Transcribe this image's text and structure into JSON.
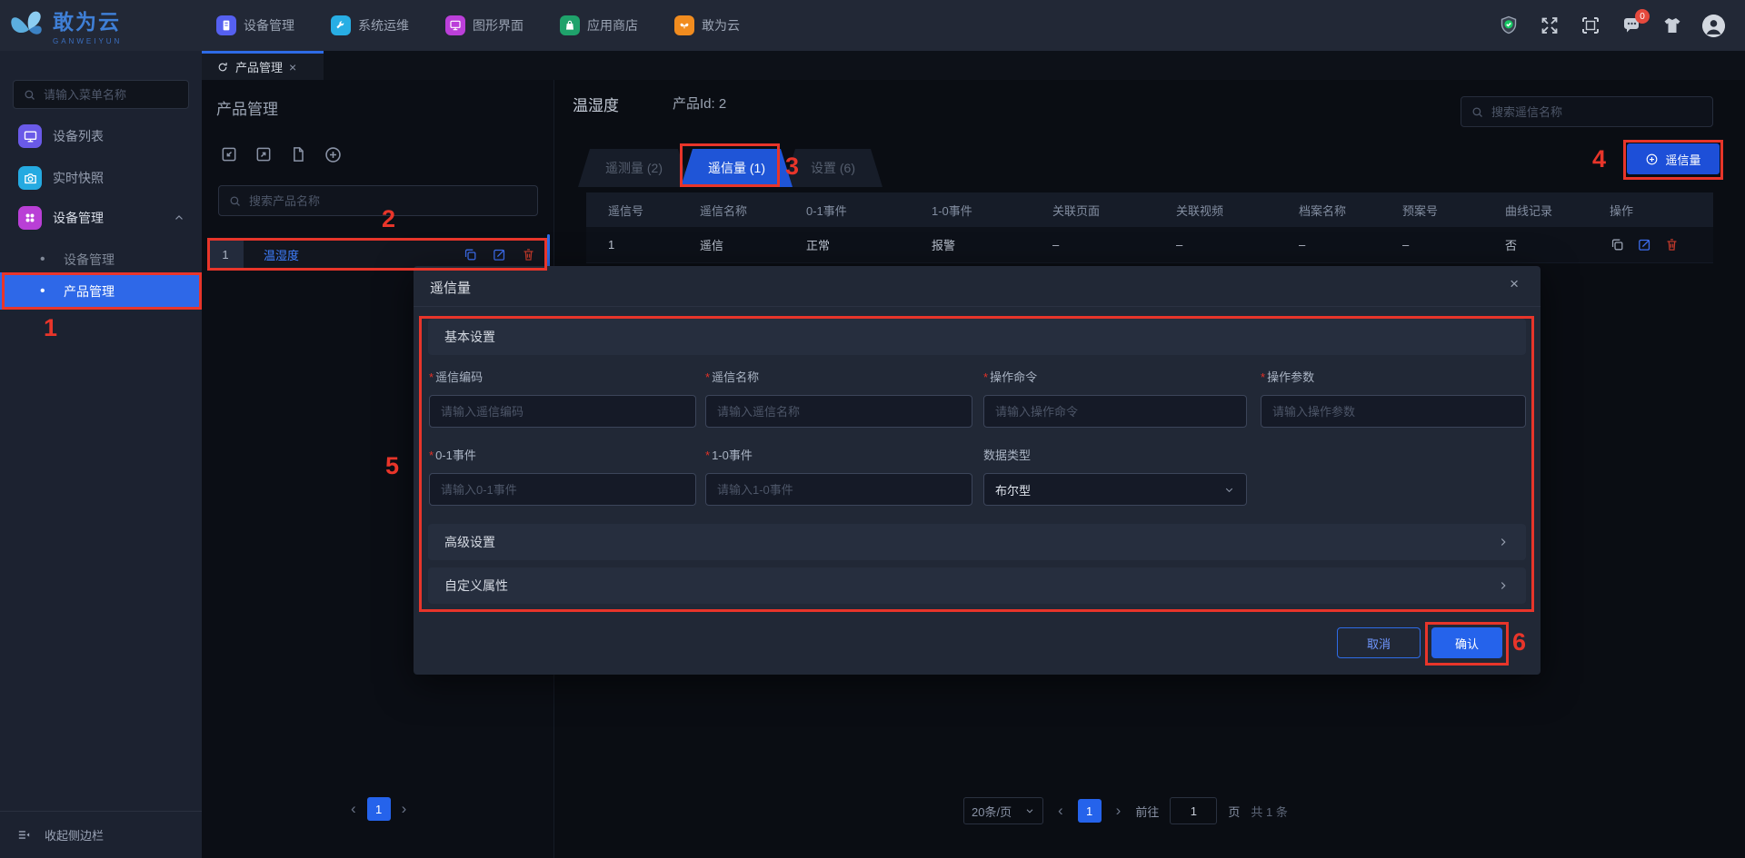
{
  "topbar": {
    "logo": {
      "title": "敢为云",
      "subtitle": "GANWEIYUN"
    },
    "nav": [
      {
        "label": "设备管理"
      },
      {
        "label": "系统运维"
      },
      {
        "label": "图形界面"
      },
      {
        "label": "应用商店"
      },
      {
        "label": "敢为云"
      }
    ],
    "message_badge": "0"
  },
  "doc_tab": {
    "label": "产品管理"
  },
  "sidebar": {
    "search_placeholder": "请输入菜单名称",
    "items": [
      {
        "label": "设备列表"
      },
      {
        "label": "实时快照"
      },
      {
        "label": "设备管理"
      }
    ],
    "sub_items": [
      {
        "label": "设备管理"
      },
      {
        "label": "产品管理"
      }
    ],
    "collapse_label": "收起侧边栏"
  },
  "product_panel": {
    "title": "产品管理",
    "search_placeholder": "搜索产品名称",
    "row": {
      "index": "1",
      "name": "温湿度"
    },
    "pagination": {
      "current": "1"
    }
  },
  "content": {
    "product_name": "温湿度",
    "product_id": "产品Id: 2",
    "search_placeholder": "搜索遥信名称",
    "add_button": "遥信量",
    "tabs": [
      {
        "label": "遥测量 (2)"
      },
      {
        "label": "遥信量 (1)"
      },
      {
        "label": "设置 (6)"
      }
    ],
    "table": {
      "columns": [
        "遥信号",
        "遥信名称",
        "0-1事件",
        "1-0事件",
        "关联页面",
        "关联视频",
        "档案名称",
        "预案号",
        "曲线记录",
        "操作"
      ],
      "row": [
        "1",
        "遥信",
        "正常",
        "报警",
        "–",
        "–",
        "–",
        "–",
        "否"
      ]
    },
    "pagination": {
      "page_size": "20条/页",
      "current": "1",
      "goto_label": "前往",
      "goto_value": "1",
      "unit_label": "页",
      "total": "共 1 条"
    }
  },
  "modal": {
    "title": "遥信量",
    "close": "×",
    "basic_section": "基本设置",
    "fields": [
      {
        "label": "遥信编码",
        "placeholder": "请输入遥信编码"
      },
      {
        "label": "遥信名称",
        "placeholder": "请输入遥信名称"
      },
      {
        "label": "操作命令",
        "placeholder": "请输入操作命令"
      },
      {
        "label": "操作参数",
        "placeholder": "请输入操作参数"
      },
      {
        "label": "0-1事件",
        "placeholder": "请输入0-1事件"
      },
      {
        "label": "1-0事件",
        "placeholder": "请输入1-0事件"
      }
    ],
    "select_field": {
      "label": "数据类型",
      "value": "布尔型"
    },
    "advanced_section": "高级设置",
    "custom_section": "自定义属性",
    "cancel": "取消",
    "confirm": "确认"
  },
  "annotations": {
    "a1": "1",
    "a2": "2",
    "a3": "3",
    "a4": "4",
    "a5": "5",
    "a6": "6"
  },
  "colors": {
    "accent": "#2e6be6",
    "annotation": "#e8352a",
    "link": "#3f7fff",
    "confirm": "#2563eb"
  }
}
